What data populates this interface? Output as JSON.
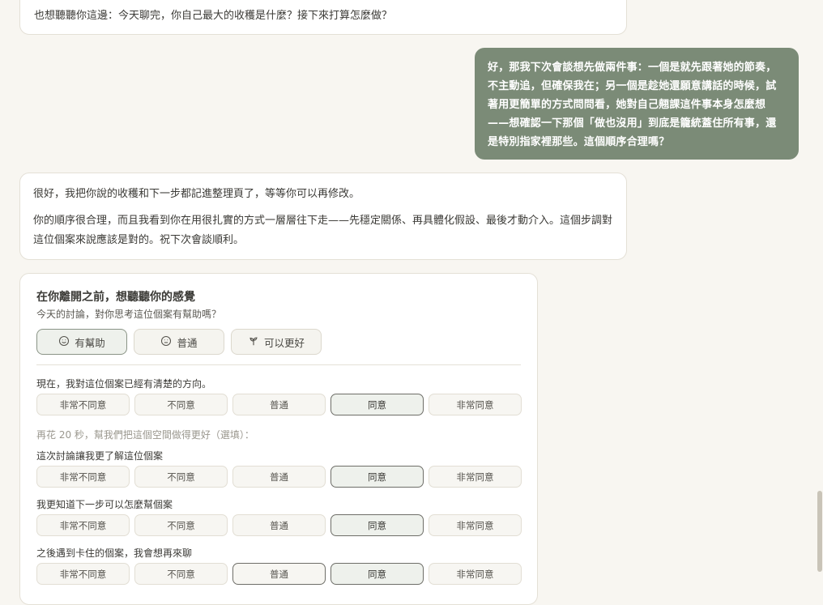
{
  "messages": {
    "ai_top": "也想聽聽你這邊：今天聊完，你自己最大的收穫是什麼？接下來打算怎麼做？",
    "user_reply": "好，那我下次會談想先做兩件事：一個是就先跟著她的節奏，不主動追，但確保我在；另一個是趁她還願意講話的時候，試著用更簡單的方式問問看，她對自己翹課這件事本身怎麼想——想確認一下那個「做也沒用」到底是籠統蓋住所有事，還是特別指家裡那些。這個順序合理嗎？",
    "ai_reply_1": "很好，我把你說的收穫和下一步都記進整理頁了，等等你可以再修改。",
    "ai_reply_2": "你的順序很合理，而且我看到你在用很扎實的方式一層層往下走——先穩定關係、再具體化假設、最後才動介入。這個步調對這位個案來說應該是對的。祝下次會談順利。"
  },
  "survey": {
    "title": "在你離開之前，想聽聽你的感覺",
    "subtitle": "今天的討論，對你思考這位個案有幫助嗎？",
    "feedback": [
      {
        "label": "有幫助",
        "icon": "smile-icon",
        "selected": true
      },
      {
        "label": "普通",
        "icon": "neutral-face-icon",
        "selected": false
      },
      {
        "label": "可以更好",
        "icon": "sprout-icon",
        "selected": false
      }
    ],
    "hint": "再花 20 秒，幫我們把這個空間做得更好（選填）：",
    "scale_options": [
      "非常不同意",
      "不同意",
      "普通",
      "同意",
      "非常同意"
    ],
    "questions": [
      {
        "label": "現在，我對這位個案已經有清楚的方向。",
        "selected": 3
      },
      {
        "label": "這次討論讓我更了解這位個案",
        "selected": 3
      },
      {
        "label": "我更知道下一步可以怎麼幫個案",
        "selected": 3
      },
      {
        "label": "之後遇到卡住的個案，我會想再來聊",
        "selected": 3
      }
    ]
  },
  "colors": {
    "user_bubble": "#7b8b77",
    "background": "#f8f6f1"
  }
}
